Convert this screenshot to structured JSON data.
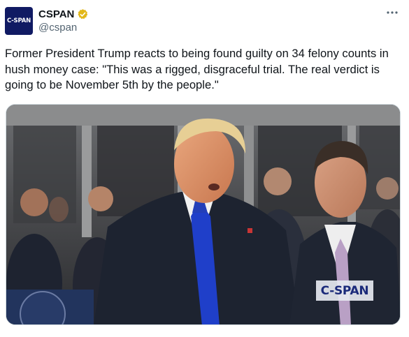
{
  "author": {
    "display_name": "CSPAN",
    "handle": "@cspan",
    "avatar_text": "C-SPAN",
    "verified_badge": "gold-verified-badge",
    "avatar_color": "#101a63"
  },
  "more_icon": "more-options-icon",
  "tweet": {
    "text": "Former President Trump reacts to being found guilty on 34 felony counts in hush money case: \"This was a rigged, disgraceful trial. The real verdict is going to be November 5th by the people.\""
  },
  "media": {
    "watermark": "C-SPAN",
    "accent_tie_color": "#1f3fc9"
  }
}
